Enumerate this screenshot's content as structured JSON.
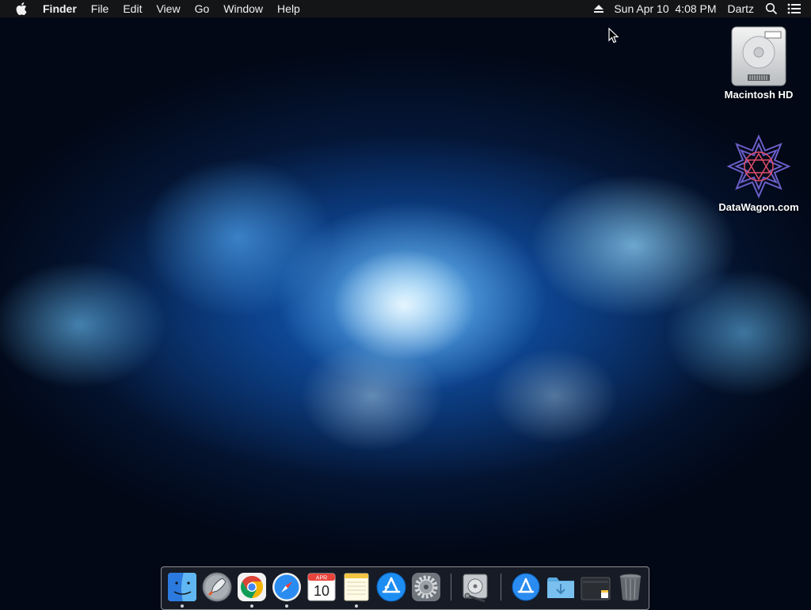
{
  "menubar": {
    "apple_icon": "apple-logo-icon",
    "app_name": "Finder",
    "menus": [
      "File",
      "Edit",
      "View",
      "Go",
      "Window",
      "Help"
    ],
    "clock": "Sun Apr 10  4:08 PM",
    "user": "Dartz",
    "status_icons": [
      "eject-icon",
      "spotlight-search-icon",
      "notification-center-icon"
    ]
  },
  "desktop": {
    "icons": [
      {
        "label": "Macintosh HD",
        "icon": "hard-drive-icon"
      },
      {
        "label": "DataWagon.com",
        "icon": "star-logo-icon"
      }
    ]
  },
  "dock": {
    "apps": [
      {
        "name": "Finder",
        "icon": "finder-icon",
        "running": true
      },
      {
        "name": "Launchpad",
        "icon": "launchpad-rocket-icon",
        "running": false
      },
      {
        "name": "Chrome",
        "icon": "chrome-icon",
        "running": true
      },
      {
        "name": "Safari",
        "icon": "safari-compass-icon",
        "running": true
      },
      {
        "name": "Calendar",
        "icon": "calendar-icon",
        "running": false,
        "month": "APR",
        "day": "10"
      },
      {
        "name": "Notes",
        "icon": "notes-icon",
        "running": true
      },
      {
        "name": "App Store",
        "icon": "app-store-icon",
        "running": false
      },
      {
        "name": "System Preferences",
        "icon": "gear-icon",
        "running": false
      },
      {
        "name": "Disk Utility",
        "icon": "disk-utility-icon",
        "running": false
      },
      {
        "name": "Applications",
        "icon": "applications-folder-icon",
        "running": false
      },
      {
        "name": "Downloads",
        "icon": "downloads-folder-icon",
        "running": false
      },
      {
        "name": "Documents",
        "icon": "documents-stack-icon",
        "running": false
      },
      {
        "name": "Trash",
        "icon": "trash-icon",
        "running": false
      }
    ]
  },
  "colors": {
    "menubar_bg": "#141517",
    "accent_blue": "#2a8cf0"
  }
}
